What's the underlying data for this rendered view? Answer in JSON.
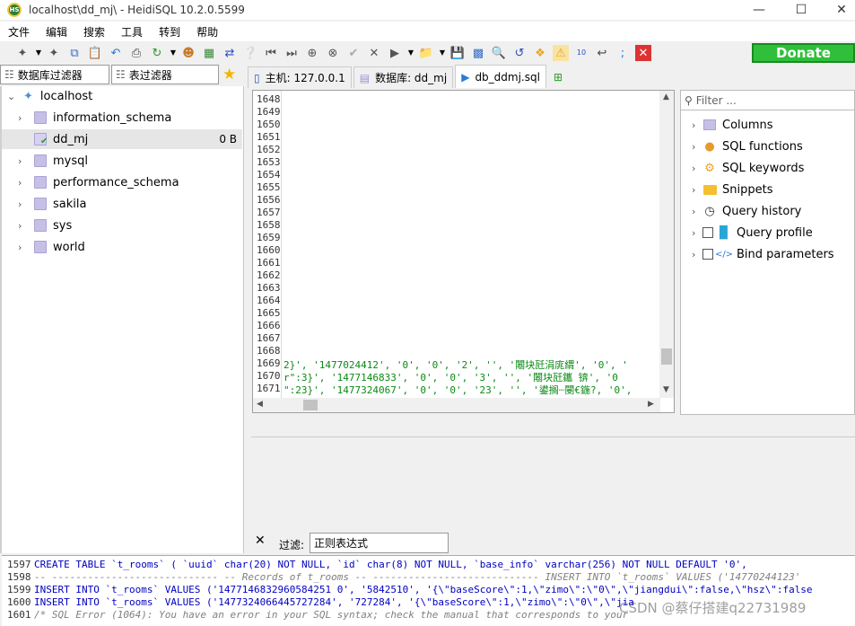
{
  "window": {
    "title": "localhost\\dd_mj\\ - HeidiSQL 10.2.0.5599",
    "app_icon_text": "HS"
  },
  "menu": [
    "文件",
    "编辑",
    "搜索",
    "工具",
    "转到",
    "帮助"
  ],
  "toolbar": {
    "donate_label": "Donate"
  },
  "left_filters": {
    "db_filter": "数据库过滤器",
    "table_filter": "表过滤器"
  },
  "tree": {
    "root": "localhost",
    "databases": [
      {
        "name": "information_schema",
        "size": ""
      },
      {
        "name": "dd_mj",
        "size": "0 B"
      },
      {
        "name": "mysql",
        "size": ""
      },
      {
        "name": "performance_schema",
        "size": ""
      },
      {
        "name": "sakila",
        "size": ""
      },
      {
        "name": "sys",
        "size": ""
      },
      {
        "name": "world",
        "size": ""
      }
    ]
  },
  "tabs": [
    {
      "label": "主机: 127.0.0.1"
    },
    {
      "label": "数据库: dd_mj"
    },
    {
      "label": "db_ddmj.sql"
    }
  ],
  "editor": {
    "line_numbers": [
      "1648",
      "1649",
      "1650",
      "1651",
      "1652",
      "1653",
      "1654",
      "1655",
      "1656",
      "1657",
      "1658",
      "1659",
      "1660",
      "1661",
      "1662",
      "1663",
      "1664",
      "1665",
      "1666",
      "1667",
      "1668",
      "1669",
      "1670",
      "1671"
    ],
    "code": [
      "2}', '1477024412', '0', '0', '2', '', '闂块瓩涓庣緭', '0', '",
      "r\":3}', '1477146833', '0', '0', '3', '', '闂块瓩鑴  锛', '0",
      "\":23}', '1477324067', '0', '0', '23', '', '鍙搁┈閿€鍦?, '0',"
    ]
  },
  "helper": {
    "filter_placeholder": "Filter ...",
    "items": [
      "Columns",
      "SQL functions",
      "SQL keywords",
      "Snippets",
      "Query history",
      "Query profile",
      "Bind parameters"
    ]
  },
  "filter_bar": {
    "label": "过滤:",
    "regex_value": "正则表达式"
  },
  "log": [
    {
      "n": "1597",
      "text": "CREATE TABLE `t_rooms` (    `uuid` char(20) NOT NULL,    `id` char(8) NOT NULL,    `base_info` varchar(256) NOT NULL DEFAULT '0',"
    },
    {
      "n": "1598",
      "text": "-- ----------------------------  -- Records of t_rooms  -- ----------------------------  INSERT INTO `t_rooms` VALUES ('14770244123'"
    },
    {
      "n": "1599",
      "text": "INSERT INTO `t_rooms` VALUES ('1477146832960584251 0', '5842510', '{\\\"baseScore\\\":1,\\\"zimo\\\":\\\"0\\\",\\\"jiangdui\\\":false,\\\"hsz\\\":false"
    },
    {
      "n": "1600",
      "text": "INSERT INTO `t_rooms` VALUES ('1477324066445727284', '727284', '{\\\"baseScore\\\":1,\\\"zimo\\\":\\\"0\\\",\\\"jia"
    },
    {
      "n": "1601",
      "text": "/* SQL Error (1064): You have an error in your SQL syntax; check the manual that corresponds to your"
    }
  ],
  "watermark": "CSDN @蔡仔搭建q22731989"
}
